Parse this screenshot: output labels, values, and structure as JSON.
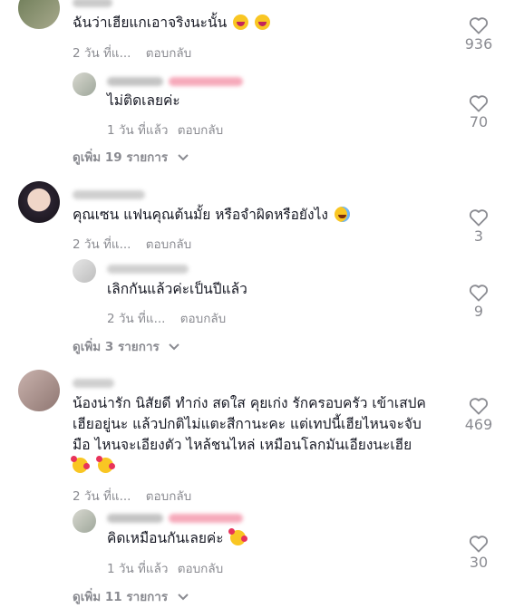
{
  "comments": [
    {
      "text": "ฉันว่าเฮียแกเอาจริงนะนั้น",
      "emojis": [
        "laugh",
        "laugh"
      ],
      "time": "2 วัน ที่แ...",
      "reply_label": "ตอบกลับ",
      "likes": "936",
      "more_label": "ดูเพิ่ม 19 รายการ",
      "reply": {
        "text": "ไม่ติดเลยค่ะ",
        "emojis": [],
        "time": "1 วัน ที่แล้ว",
        "reply_label": "ตอบกลับ",
        "likes": "70"
      }
    },
    {
      "text": "คุณเซน แฟนคุณต้นมั้ย หรือจำผิดหรือยังไง",
      "emojis": [
        "tears"
      ],
      "time": "2 วัน ที่แ...",
      "reply_label": "ตอบกลับ",
      "likes": "3",
      "more_label": "ดูเพิ่ม 3 รายการ",
      "reply": {
        "text": "เลิกกันแล้วค่ะเป็นปีแล้ว",
        "emojis": [],
        "time": "2 วัน ที่แ...",
        "reply_label": "ตอบกลับ",
        "likes": "9"
      }
    },
    {
      "lines": [
        "น้องน่ารัก นิสัยดี ทำก่ง สดใส คุยเก่ง รักครอบครัว เข้าเสปค",
        "เฮียอยู่นะ แล้วปกติไม่แตะสีกานะคะ แต่เทปนี้เฮียไหนจะจับ",
        "มือ ไหนจะเอียงตัว ไหล้ชนไหล่ เหมือนโลกมันเอียงนะเฮีย"
      ],
      "emojis": [
        "hearts",
        "hearts"
      ],
      "time": "2 วัน ที่แ...",
      "reply_label": "ตอบกลับ",
      "likes": "469",
      "more_label": "ดูเพิ่ม 11 รายการ",
      "reply": {
        "text": "คิดเหมือนกันเลยค่ะ",
        "emojis": [
          "hearts"
        ],
        "time": "1 วัน ที่แล้ว",
        "reply_label": "ตอบกลับ",
        "likes": "30"
      }
    }
  ],
  "colors": {
    "text": "#161823",
    "muted": "#8a8b91",
    "creator_badge": "#fe2c55"
  },
  "icons": {
    "like": "heart-outline-icon",
    "expand": "chevron-down-icon"
  }
}
